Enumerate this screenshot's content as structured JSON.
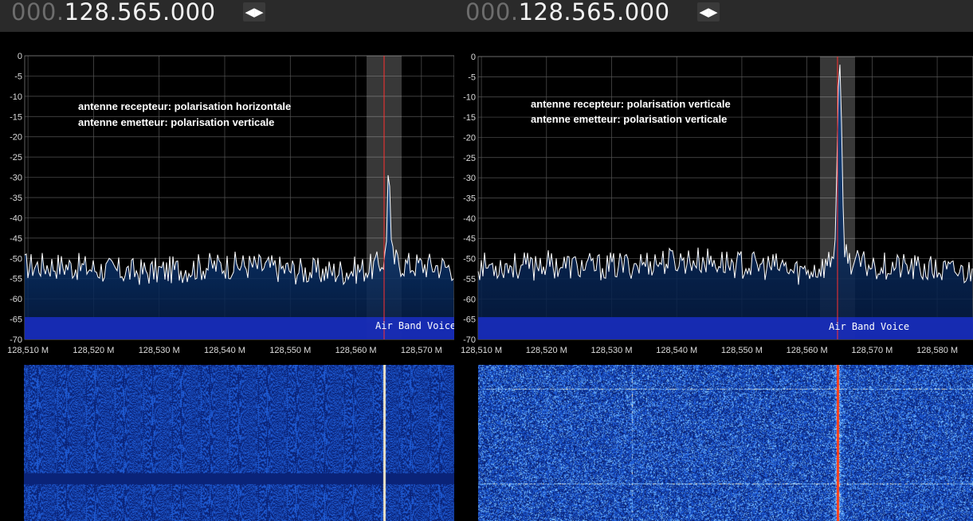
{
  "panels": [
    {
      "frequency": {
        "prefix": "000.",
        "value": "128.565.000"
      },
      "annotation": {
        "line1": "antenne recepteur: polarisation horizontale",
        "line2": "antenne emetteur: polarisation verticale"
      },
      "band_label": "Air Band Voice",
      "y_ticks": [
        "0",
        "-5",
        "-10",
        "-15",
        "-20",
        "-25",
        "-30",
        "-35",
        "-40",
        "-45",
        "-50",
        "-55",
        "-60",
        "-65",
        "-70"
      ],
      "x_ticks": [
        "128,510 M",
        "128,520 M",
        "128,530 M",
        "128,540 M",
        "128,550 M",
        "128,560 M",
        "128,570 M"
      ],
      "signal": {
        "freq_mhz": 128.565,
        "peak_db": -28
      }
    },
    {
      "frequency": {
        "prefix": "000.",
        "value": "128.565.000"
      },
      "annotation": {
        "line1": "antenne recepteur: polarisation verticale",
        "line2": "antenne emetteur: polarisation verticale"
      },
      "band_label": "Air Band Voice",
      "y_ticks": [
        "0",
        "-5",
        "-10",
        "-15",
        "-20",
        "-25",
        "-30",
        "-35",
        "-40",
        "-45",
        "-50",
        "-55",
        "-60",
        "-65",
        "-70"
      ],
      "x_ticks": [
        "128,510 M",
        "128,520 M",
        "128,530 M",
        "128,540 M",
        "128,550 M",
        "128,560 M",
        "128,570 M",
        "128,580 M"
      ],
      "signal": {
        "freq_mhz": 128.565,
        "peak_db": -9
      }
    }
  ],
  "colors": {
    "grid": "#555555",
    "trace": "#ffffff",
    "marker": "#ff3030",
    "band": "#1a2ec8",
    "background": "#000000"
  }
}
